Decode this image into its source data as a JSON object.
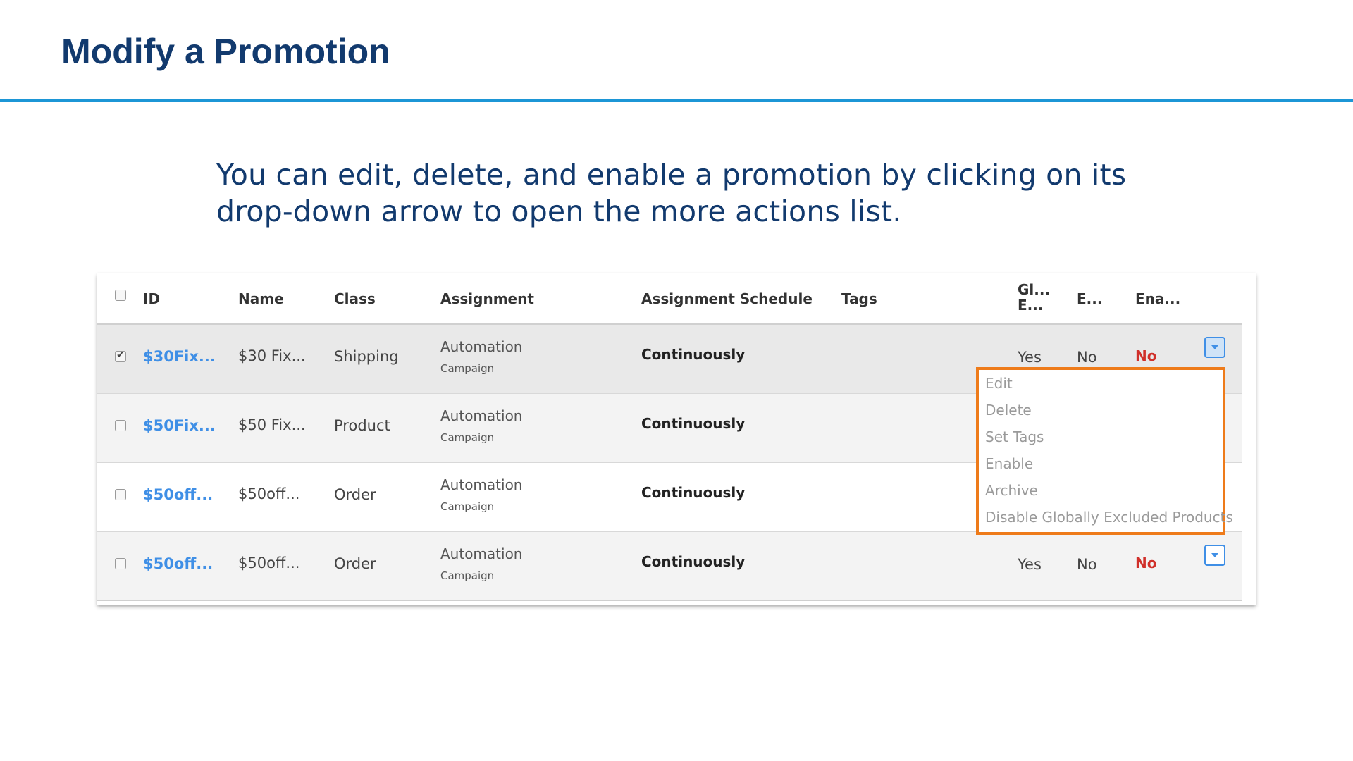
{
  "slide": {
    "title": "Modify a Promotion",
    "intro_line1": "You can edit, delete, and enable a promotion by clicking on its",
    "intro_line2": "drop-down arrow to open the more actions list."
  },
  "table": {
    "columns": {
      "id": "ID",
      "name": "Name",
      "class": "Class",
      "assignment": "Assignment",
      "assignment_schedule": "Assignment Schedule",
      "tags": "Tags",
      "globally_excluded_l1": "Gl...",
      "globally_excluded_l2": "E...",
      "e": "E...",
      "enabled": "Ena..."
    },
    "rows": [
      {
        "checked": true,
        "id": "$30Fix...",
        "name": "$30 Fix...",
        "class": "Shipping",
        "assignment": "Automation",
        "assignment_sub": "Campaign",
        "schedule": "Continuously",
        "globally_excluded": "Yes",
        "e": "No",
        "enabled": "No"
      },
      {
        "checked": false,
        "id": "$50Fix...",
        "name": "$50 Fix...",
        "class": "Product",
        "assignment": "Automation",
        "assignment_sub": "Campaign",
        "schedule": "Continuously",
        "globally_excluded": "",
        "e": "",
        "enabled": ""
      },
      {
        "checked": false,
        "id": "$50off...",
        "name": "$50off...",
        "class": "Order",
        "assignment": "Automation",
        "assignment_sub": "Campaign",
        "schedule": "Continuously",
        "globally_excluded": "",
        "e": "",
        "enabled": ""
      },
      {
        "checked": false,
        "id": "$50off...",
        "name": "$50off...",
        "class": "Order",
        "assignment": "Automation",
        "assignment_sub": "Campaign",
        "schedule": "Continuously",
        "globally_excluded": "Yes",
        "e": "No",
        "enabled": "No"
      }
    ]
  },
  "actions_menu": {
    "items": [
      "Edit",
      "Delete",
      "Set Tags",
      "Enable",
      "Archive",
      "Disable Globally Excluded Products"
    ]
  },
  "colors": {
    "title": "#123a6e",
    "rule": "#1c96d6",
    "link": "#3f8fe6",
    "status_no": "#d0302a",
    "highlight": "#ee7b1a"
  }
}
